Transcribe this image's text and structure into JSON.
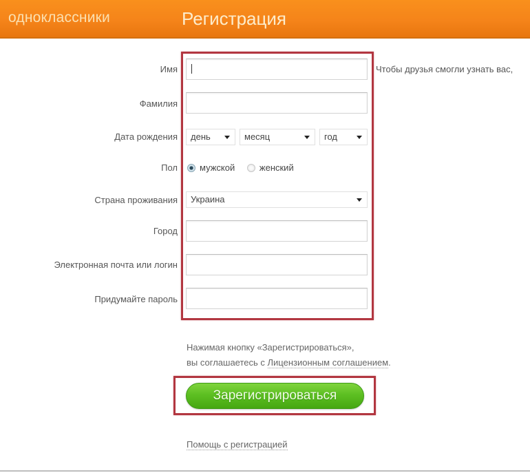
{
  "header": {
    "brand": "одноклассники",
    "title": "Регистрация"
  },
  "form": {
    "first_name": {
      "label": "Имя",
      "value": "",
      "hint": "Чтобы друзья смогли узнать вас,"
    },
    "last_name": {
      "label": "Фамилия",
      "value": ""
    },
    "birth_date": {
      "label": "Дата рождения",
      "day": "день",
      "month": "месяц",
      "year": "год"
    },
    "gender": {
      "label": "Пол",
      "options": [
        {
          "label": "мужской",
          "checked": true
        },
        {
          "label": "женский",
          "checked": false
        }
      ]
    },
    "country": {
      "label": "Страна проживания",
      "value": "Украина"
    },
    "city": {
      "label": "Город",
      "value": ""
    },
    "email": {
      "label": "Электронная почта или логин",
      "value": ""
    },
    "password": {
      "label": "Придумайте пароль",
      "value": ""
    }
  },
  "agreement": {
    "line1": "Нажимая кнопку «Зарегистрироваться»,",
    "line2_prefix": "вы соглашаетесь с ",
    "link": "Лицензионным соглашением",
    "line2_suffix": "."
  },
  "register_button": "Зарегистрироваться",
  "help_link": "Помощь с регистрацией",
  "colors": {
    "header_orange": "#f5841a",
    "highlight_red": "#b23640",
    "button_green": "#5dbf22"
  }
}
